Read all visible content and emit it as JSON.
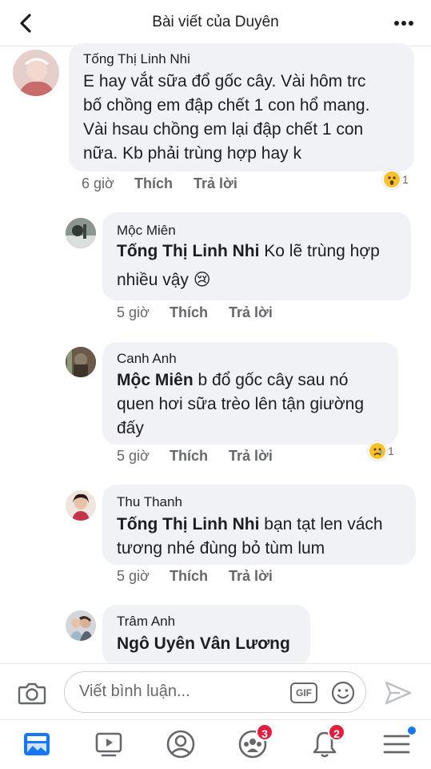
{
  "header": {
    "title": "Bài viết của Duyên"
  },
  "comments": [
    {
      "author": "Tống Thị Linh Nhi",
      "mention": "",
      "lines": [
        "E hay vắt sữa đổ gốc cây. Vài hôm trc",
        "bố chồng em đập chết 1 con hổ mang.",
        "Vài hsau chồng em lại đập chết 1 con",
        "nữa. Kb phải trùng hợp hay k"
      ],
      "time": "6 giờ",
      "like": "Thích",
      "reply": "Trả lời",
      "reaction": "wow",
      "reaction_count": "1"
    },
    {
      "author": "Mộc Miên",
      "mention": "Tống Thị Linh Nhi",
      "lines": [
        " Ko lẽ trùng hợp",
        "nhiều vậy 😢"
      ],
      "time": "5 giờ",
      "like": "Thích",
      "reply": "Trả lời"
    },
    {
      "author": "Canh Anh",
      "mention": "Mộc Miên",
      "lines": [
        " b đổ gốc cây sau nó",
        "quen hơi sữa trèo lên tận giường",
        "đấy"
      ],
      "time": "5 giờ",
      "like": "Thích",
      "reply": "Trả lời",
      "reaction": "sad",
      "reaction_count": "1"
    },
    {
      "author": "Thu Thanh",
      "mention": "Tống Thị Linh Nhi",
      "lines": [
        " bạn tạt len vách",
        "tương nhé đùng bỏ tùm lum"
      ],
      "time": "5 giờ",
      "like": "Thích",
      "reply": "Trả lời"
    },
    {
      "author": "Trâm Anh",
      "mention": "Ngô Uyên Vân Lương",
      "lines": [
        ""
      ]
    }
  ],
  "composer": {
    "placeholder": "Viết bình luận...",
    "gif_label": "GIF"
  },
  "nav": {
    "groups_badge": "3",
    "notifications_badge": "2"
  },
  "icons": {
    "back": "chevron-left-icon",
    "more": "more-dots-icon",
    "camera": "camera-icon",
    "sticker": "smiley-icon",
    "send": "send-icon",
    "feed": "news-feed-icon",
    "watch": "video-play-icon",
    "profile": "profile-icon",
    "groups": "groups-icon",
    "notifications": "bell-icon",
    "menu": "hamburger-menu-icon"
  },
  "colors": {
    "accent": "#1877f2",
    "bubble": "#f0f2f5",
    "badge": "#e41e3f"
  }
}
